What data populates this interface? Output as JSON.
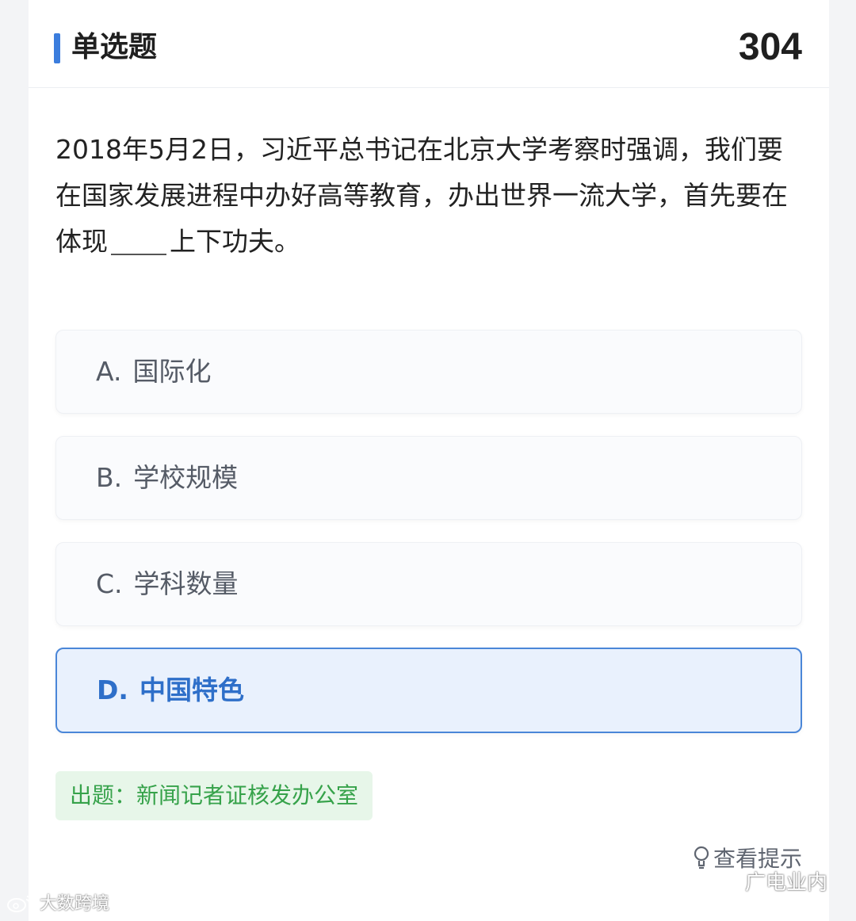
{
  "header": {
    "title": "单选题",
    "question_number": "304",
    "accent_color": "#3b7ddd"
  },
  "question": {
    "text_before": "2018年5月2日，习近平总书记在北京大学考察时强调，我们要在国家发展进程中办好高等教育，办出世界一流大学，首先要在体现",
    "text_after": "上下功夫。"
  },
  "options": [
    {
      "letter": "A.",
      "label": "国际化",
      "selected": false
    },
    {
      "letter": "B.",
      "label": "学校规模",
      "selected": false
    },
    {
      "letter": "C.",
      "label": "学科数量",
      "selected": false
    },
    {
      "letter": "D.",
      "label": "中国特色",
      "selected": true
    }
  ],
  "source": {
    "text": "出题：新闻记者证核发办公室",
    "color": "#36a24a"
  },
  "hint": {
    "label": "查看提示",
    "icon": "lightbulb-icon"
  },
  "watermarks": {
    "left": "大数跨境",
    "right": "广电业内"
  },
  "colors": {
    "selected_border": "#4a86d8",
    "selected_bg": "#e9f1fd",
    "selected_text": "#2e6fc9"
  }
}
